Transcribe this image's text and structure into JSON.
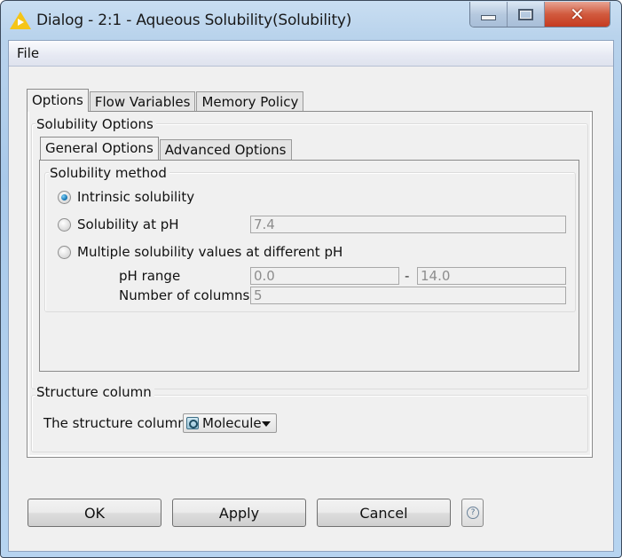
{
  "window": {
    "title": "Dialog - 2:1 - Aqueous Solubility(Solubility)",
    "controls": {
      "minimize": "minimize",
      "maximize": "maximize",
      "close": "✕"
    }
  },
  "menu": {
    "file": "File"
  },
  "outer_tabs": [
    {
      "label": "Options",
      "active": true
    },
    {
      "label": "Flow Variables",
      "active": false
    },
    {
      "label": "Memory Policy",
      "active": false
    }
  ],
  "solubility_options": {
    "legend": "Solubility Options",
    "inner_tabs": [
      {
        "label": "General Options",
        "active": true
      },
      {
        "label": "Advanced Options",
        "active": false
      }
    ],
    "method": {
      "legend": "Solubility method",
      "options": [
        {
          "label": "Intrinsic solubility",
          "selected": true
        },
        {
          "label": "Solubility at pH",
          "selected": false
        },
        {
          "label": "Multiple solubility values at different pH",
          "selected": false
        }
      ],
      "ph_value": "7.4",
      "ph_range_label": "pH range",
      "ph_range_min": "0.0",
      "ph_range_sep": "-",
      "ph_range_max": "14.0",
      "num_columns_label": "Number of columns",
      "num_columns": "5"
    }
  },
  "structure": {
    "legend": "Structure column",
    "label": "The structure column",
    "selected": "Molecule"
  },
  "buttons": {
    "ok": "OK",
    "apply": "Apply",
    "cancel": "Cancel",
    "help": "?"
  }
}
